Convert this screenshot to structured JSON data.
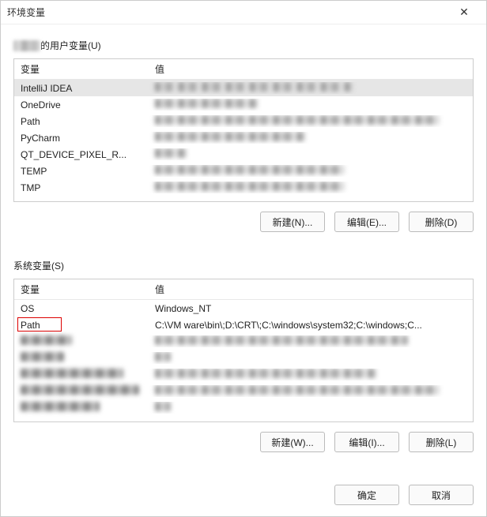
{
  "dialog": {
    "title": "环境变量",
    "close_label": "✕"
  },
  "user_section": {
    "label_suffix": "的用户变量(U)",
    "header_var": "变量",
    "header_val": "值",
    "rows": [
      {
        "var": "IntelliJ IDEA",
        "val": "",
        "blurred_val": true,
        "val_width": 250,
        "selected": true
      },
      {
        "var": "OneDrive",
        "val": "",
        "blurred_val": true,
        "val_width": 130
      },
      {
        "var": "Path",
        "val": "",
        "blurred_val": true,
        "val_width": 360
      },
      {
        "var": "PyCharm",
        "val": "",
        "blurred_val": true,
        "val_width": 190
      },
      {
        "var": "QT_DEVICE_PIXEL_R...",
        "val": "",
        "blurred_val": true,
        "val_width": 40
      },
      {
        "var": "TEMP",
        "val": "",
        "blurred_val": true,
        "val_width": 240
      },
      {
        "var": "TMP",
        "val": "",
        "blurred_val": true,
        "val_width": 240
      }
    ],
    "buttons": {
      "new": "新建(N)...",
      "edit": "编辑(E)...",
      "delete": "删除(D)"
    }
  },
  "system_section": {
    "label": "系统变量(S)",
    "header_var": "变量",
    "header_val": "值",
    "rows": [
      {
        "var": "OS",
        "val": "Windows_NT"
      },
      {
        "var": "Path",
        "val": "C:\\VM ware\\bin\\;D:\\CRT\\;C:\\windows\\system32;C:\\windows;C...",
        "highlighted_var": true
      },
      {
        "var": "",
        "val": "",
        "blurred_var": true,
        "var_width": 65,
        "blurred_val": true,
        "val_width": 320
      },
      {
        "var": "",
        "val": "",
        "blurred_var": true,
        "var_width": 55,
        "blurred_val": true,
        "val_width": 20
      },
      {
        "var": "",
        "val": "",
        "blurred_var": true,
        "var_width": 130,
        "blurred_val": true,
        "val_width": 280
      },
      {
        "var": "",
        "val": "",
        "blurred_var": true,
        "var_width": 150,
        "blurred_val": true,
        "val_width": 360
      },
      {
        "var": "",
        "val": "",
        "blurred_var": true,
        "var_width": 100,
        "blurred_val": true,
        "val_width": 20
      }
    ],
    "buttons": {
      "new": "新建(W)...",
      "edit": "编辑(I)...",
      "delete": "删除(L)"
    }
  },
  "footer": {
    "ok": "确定",
    "cancel": "取消"
  }
}
